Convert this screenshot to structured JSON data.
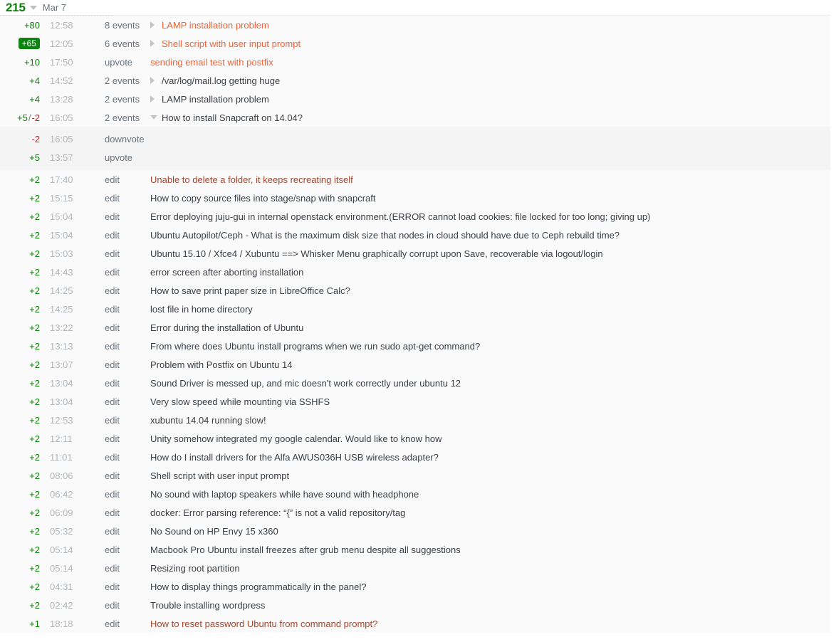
{
  "day_header": {
    "total": "215",
    "date": "Mar 7",
    "collapse_icon": "triangle-down-icon"
  },
  "colors": {
    "positive": "#0a8405",
    "negative": "#b52b27",
    "badge_bg": "#0d8312",
    "hot_link": "#ef6335",
    "visited_link": "#a0462e",
    "normal_text": "#3b4045",
    "muted": "#b1b6ba",
    "row_bg": "#fafafa",
    "expanded_bg": "#f4f4f4"
  },
  "events": [
    {
      "rep": "+80",
      "rep_style": "pos",
      "badge": false,
      "time": "12:58",
      "type": "8 events",
      "title": "LAMP installation problem",
      "link_style": "hot",
      "toggle": "collapsed"
    },
    {
      "rep": "+65",
      "rep_style": "pos",
      "badge": true,
      "time": "12:05",
      "type": "6 events",
      "title": "Shell script with user input prompt",
      "link_style": "hot",
      "toggle": "collapsed"
    },
    {
      "rep": "+10",
      "rep_style": "pos",
      "badge": false,
      "time": "17:50",
      "type": "upvote",
      "title": "sending email test with postfix",
      "link_style": "hot",
      "toggle": "none"
    },
    {
      "rep": "+4",
      "rep_style": "pos",
      "badge": false,
      "time": "14:52",
      "type": "2 events",
      "title": "/var/log/mail.log getting huge",
      "link_style": "normal",
      "toggle": "collapsed"
    },
    {
      "rep": "+4",
      "rep_style": "pos",
      "badge": false,
      "time": "13:28",
      "type": "2 events",
      "title": "LAMP installation problem",
      "link_style": "normal",
      "toggle": "collapsed"
    },
    {
      "rep_split": {
        "pos": "+5",
        "sep": "/",
        "neg": "-2"
      },
      "badge": false,
      "time": "16:05",
      "type": "2 events",
      "title": "How to install Snapcraft on 14.04?",
      "link_style": "normal",
      "toggle": "expanded",
      "children": [
        {
          "rep": "-2",
          "rep_style": "neg",
          "time": "16:05",
          "type": "downvote",
          "title": ""
        },
        {
          "rep": "+5",
          "rep_style": "pos",
          "time": "13:57",
          "type": "upvote",
          "title": ""
        }
      ]
    },
    {
      "rep": "+2",
      "rep_style": "pos",
      "badge": false,
      "time": "17:40",
      "type": "edit",
      "title": "Unable to delete a folder, it keeps recreating itself",
      "link_style": "visited",
      "toggle": "none"
    },
    {
      "rep": "+2",
      "rep_style": "pos",
      "badge": false,
      "time": "15:15",
      "type": "edit",
      "title": "How to copy source files into stage/snap with snapcraft",
      "link_style": "normal",
      "toggle": "none"
    },
    {
      "rep": "+2",
      "rep_style": "pos",
      "badge": false,
      "time": "15:04",
      "type": "edit",
      "title": "Error deploying juju-gui in internal openstack environment.(ERROR cannot load cookies: file locked for too long; giving up)",
      "link_style": "normal",
      "toggle": "none"
    },
    {
      "rep": "+2",
      "rep_style": "pos",
      "badge": false,
      "time": "15:04",
      "type": "edit",
      "title": "Ubuntu Autopilot/Ceph - What is the maximum disk size that nodes in cloud should have due to Ceph rebuild time?",
      "link_style": "normal",
      "toggle": "none"
    },
    {
      "rep": "+2",
      "rep_style": "pos",
      "badge": false,
      "time": "15:03",
      "type": "edit",
      "title": "Ubuntu 15.10 / Xfce4 / Xubuntu ==> Whisker Menu graphically corrupt upon Save, recoverable via logout/login",
      "link_style": "normal",
      "toggle": "none"
    },
    {
      "rep": "+2",
      "rep_style": "pos",
      "badge": false,
      "time": "14:43",
      "type": "edit",
      "title": "error screen after aborting installation",
      "link_style": "normal",
      "toggle": "none"
    },
    {
      "rep": "+2",
      "rep_style": "pos",
      "badge": false,
      "time": "14:25",
      "type": "edit",
      "title": "How to save print paper size in LibreOffice Calc?",
      "link_style": "normal",
      "toggle": "none"
    },
    {
      "rep": "+2",
      "rep_style": "pos",
      "badge": false,
      "time": "14:25",
      "type": "edit",
      "title": "lost file in home directory",
      "link_style": "normal",
      "toggle": "none"
    },
    {
      "rep": "+2",
      "rep_style": "pos",
      "badge": false,
      "time": "13:22",
      "type": "edit",
      "title": "Error during the installation of Ubuntu",
      "link_style": "normal",
      "toggle": "none"
    },
    {
      "rep": "+2",
      "rep_style": "pos",
      "badge": false,
      "time": "13:13",
      "type": "edit",
      "title": "From where does Ubuntu install programs when we run sudo apt-get command?",
      "link_style": "normal",
      "toggle": "none"
    },
    {
      "rep": "+2",
      "rep_style": "pos",
      "badge": false,
      "time": "13:07",
      "type": "edit",
      "title": "Problem with Postfix on Ubuntu 14",
      "link_style": "normal",
      "toggle": "none"
    },
    {
      "rep": "+2",
      "rep_style": "pos",
      "badge": false,
      "time": "13:04",
      "type": "edit",
      "title": "Sound Driver is messed up, and mic doesn't work correctly under ubuntu 12",
      "link_style": "normal",
      "toggle": "none"
    },
    {
      "rep": "+2",
      "rep_style": "pos",
      "badge": false,
      "time": "13:04",
      "type": "edit",
      "title": "Very slow speed while mounting via SSHFS",
      "link_style": "normal",
      "toggle": "none"
    },
    {
      "rep": "+2",
      "rep_style": "pos",
      "badge": false,
      "time": "12:53",
      "type": "edit",
      "title": "xubuntu 14.04 running slow!",
      "link_style": "normal",
      "toggle": "none"
    },
    {
      "rep": "+2",
      "rep_style": "pos",
      "badge": false,
      "time": "12:11",
      "type": "edit",
      "title": "Unity somehow integrated my google calendar. Would like to know how",
      "link_style": "normal",
      "toggle": "none"
    },
    {
      "rep": "+2",
      "rep_style": "pos",
      "badge": false,
      "time": "11:01",
      "type": "edit",
      "title": "How do I install drivers for the Alfa AWUS036H USB wireless adapter?",
      "link_style": "normal",
      "toggle": "none"
    },
    {
      "rep": "+2",
      "rep_style": "pos",
      "badge": false,
      "time": "08:06",
      "type": "edit",
      "title": "Shell script with user input prompt",
      "link_style": "normal",
      "toggle": "none"
    },
    {
      "rep": "+2",
      "rep_style": "pos",
      "badge": false,
      "time": "06:42",
      "type": "edit",
      "title": "No sound with laptop speakers while have sound with headphone",
      "link_style": "normal",
      "toggle": "none"
    },
    {
      "rep": "+2",
      "rep_style": "pos",
      "badge": false,
      "time": "06:09",
      "type": "edit",
      "title": "docker: Error parsing reference: “{” is not a valid repository/tag",
      "link_style": "normal",
      "toggle": "none"
    },
    {
      "rep": "+2",
      "rep_style": "pos",
      "badge": false,
      "time": "05:32",
      "type": "edit",
      "title": "No Sound on HP Envy 15 x360",
      "link_style": "normal",
      "toggle": "none"
    },
    {
      "rep": "+2",
      "rep_style": "pos",
      "badge": false,
      "time": "05:14",
      "type": "edit",
      "title": "Macbook Pro Ubuntu install freezes after grub menu despite all suggestions",
      "link_style": "normal",
      "toggle": "none"
    },
    {
      "rep": "+2",
      "rep_style": "pos",
      "badge": false,
      "time": "05:14",
      "type": "edit",
      "title": "Resizing root partition",
      "link_style": "normal",
      "toggle": "none"
    },
    {
      "rep": "+2",
      "rep_style": "pos",
      "badge": false,
      "time": "04:31",
      "type": "edit",
      "title": "How to display things programmatically in the panel?",
      "link_style": "normal",
      "toggle": "none"
    },
    {
      "rep": "+2",
      "rep_style": "pos",
      "badge": false,
      "time": "02:42",
      "type": "edit",
      "title": "Trouble installing wordpress",
      "link_style": "normal",
      "toggle": "none"
    },
    {
      "rep": "+1",
      "rep_style": "pos",
      "badge": false,
      "time": "18:18",
      "type": "edit",
      "title": "How to reset password Ubuntu from command prompt?",
      "link_style": "visited",
      "toggle": "none"
    }
  ]
}
